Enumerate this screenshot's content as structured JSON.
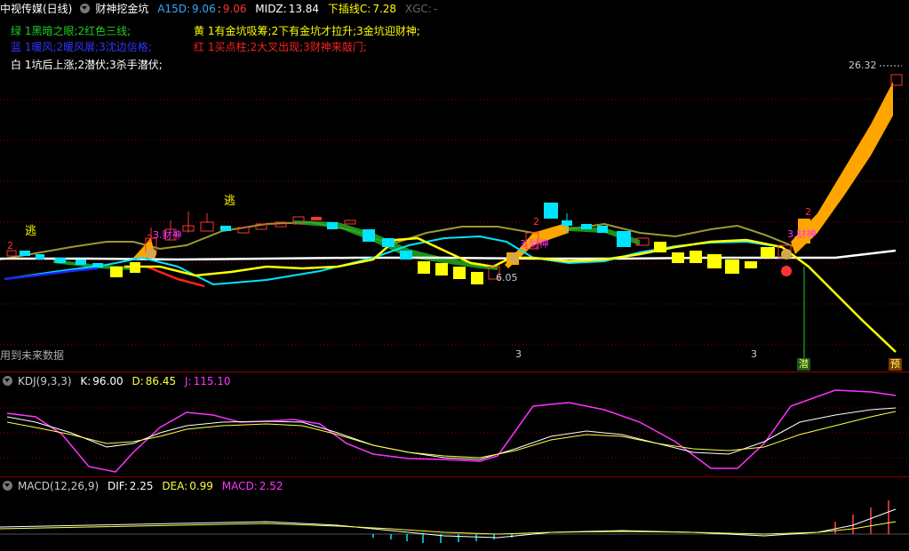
{
  "main": {
    "title": "中视传媒(日线)",
    "indicator": "财神挖金坑",
    "a15d_label": "A15D:",
    "a15d_value1": "9.06",
    "a15d_value2": "9.06",
    "midz_label": "MIDZ:",
    "midz_value": "13.84",
    "xiachaxian_label": "下插线C:",
    "xiachaxian_value": "7.28",
    "xgc_label": "XGC:",
    "xgc_value": "-",
    "legend_green": "绿 1黑暗之眼;2红色三线;",
    "legend_yellow": "黄 1有金坑吸筹;2下有金坑才拉升;3金坑迎财神;",
    "legend_blue": "蓝 1暖风;2暖风展;3沈边信格;",
    "legend_red": "红 1买点柱;2大叉出现;3财神来敲门;",
    "legend_white": "白 1坑后上涨;2潜伏;3杀手潜伏;",
    "price_high": "26.32",
    "price_low_marker": "6.05",
    "future_note": "用到未来数据",
    "escape_1": "逃",
    "escape_2": "逃",
    "wave_label_1": "3",
    "wave_label_2": "3",
    "god_label_1": "3.财神",
    "god_label_2": "3.财神",
    "god_label_3": "3.财神",
    "num_2a": "2",
    "num_2b": "2",
    "num_2c": "2",
    "num_2d": "2",
    "tag_qian": "潜",
    "tag_yu": "预"
  },
  "kdj": {
    "title": "KDJ(9,3,3)",
    "k_label": "K:",
    "k_value": "96.00",
    "d_label": "D:",
    "d_value": "86.45",
    "j_label": "J:",
    "j_value": "115.10"
  },
  "macd": {
    "title": "MACD(12,26,9)",
    "dif_label": "DIF:",
    "dif_value": "2.25",
    "dea_label": "DEA:",
    "dea_value": "0.99",
    "macd_label": "MACD:",
    "macd_value": "2.52"
  },
  "colors": {
    "green": "#22cc22",
    "yellow": "#ffff00",
    "blue": "#3333ff",
    "red": "#ff2020",
    "white": "#ffffff",
    "cyan": "#00e5ff",
    "orange": "#ffa500",
    "magenta": "#ff33ff",
    "olive": "#9c9a2c"
  }
}
